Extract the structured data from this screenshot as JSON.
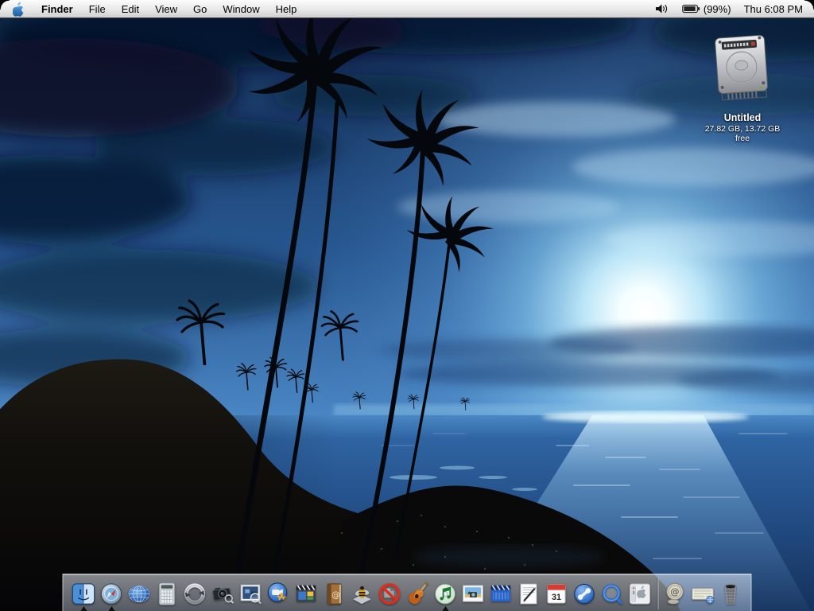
{
  "menu_bar": {
    "apple_menu": {
      "icon": "apple-logo"
    },
    "menus": [
      {
        "label": "Finder",
        "bold": true
      },
      {
        "label": "File"
      },
      {
        "label": "Edit"
      },
      {
        "label": "View"
      },
      {
        "label": "Go"
      },
      {
        "label": "Window"
      },
      {
        "label": "Help"
      }
    ],
    "status": {
      "volume_icon": "speaker-icon",
      "battery_icon": "battery-icon",
      "battery_percent": "(99%)",
      "clock": "Thu 6:08 PM"
    }
  },
  "desktop": {
    "volume": {
      "icon": "hard-drive-icon",
      "label": "Untitled",
      "detail": "27.82 GB, 13.72 GB free"
    },
    "wallpaper_colors": {
      "sky_dark": "#0d1d3a",
      "sky_glow": "#ffffff",
      "sky_bright": "#bfe8ff",
      "ocean": "#2a5d9e",
      "land_silhouette": "#0a0a0c"
    }
  },
  "dock": {
    "items": [
      {
        "id": "finder",
        "label": "Finder",
        "running": true
      },
      {
        "id": "safari",
        "label": "Safari",
        "running": true
      },
      {
        "id": "globe",
        "label": "Internet globe",
        "running": false
      },
      {
        "id": "calculator",
        "label": "Calculator",
        "running": false
      },
      {
        "id": "isync",
        "label": "Sync",
        "running": false
      },
      {
        "id": "camera",
        "label": "Image Capture",
        "running": false
      },
      {
        "id": "preview",
        "label": "Preview",
        "running": false
      },
      {
        "id": "ichatav",
        "label": "iChat AV",
        "running": false
      },
      {
        "id": "imovie",
        "label": "iMovie",
        "running": false
      },
      {
        "id": "addressbook",
        "label": "Address Book",
        "running": false
      },
      {
        "id": "bee",
        "label": "Bee",
        "running": false
      },
      {
        "id": "nosign",
        "label": "No-entry",
        "running": false
      },
      {
        "id": "garageband",
        "label": "GarageBand",
        "running": false
      },
      {
        "id": "itunes",
        "label": "iTunes",
        "running": true
      },
      {
        "id": "iphoto",
        "label": "iPhoto",
        "running": false
      },
      {
        "id": "imoviehd",
        "label": "iMovie HD",
        "running": false
      },
      {
        "id": "textedit",
        "label": "TextEdit",
        "running": false
      },
      {
        "id": "ical",
        "label": "iCal",
        "running": false
      },
      {
        "id": "phone",
        "label": "Phone",
        "running": false
      },
      {
        "id": "quicktime",
        "label": "QuickTime Player",
        "running": false
      },
      {
        "id": "sysprefs",
        "label": "System Preferences",
        "running": false
      }
    ],
    "right_items": [
      {
        "id": "atstamp",
        "label": "Internet location",
        "running": false
      },
      {
        "id": "keyboarddoc",
        "label": "Keyboard document",
        "running": false
      },
      {
        "id": "trash",
        "label": "Trash",
        "running": false
      }
    ]
  }
}
